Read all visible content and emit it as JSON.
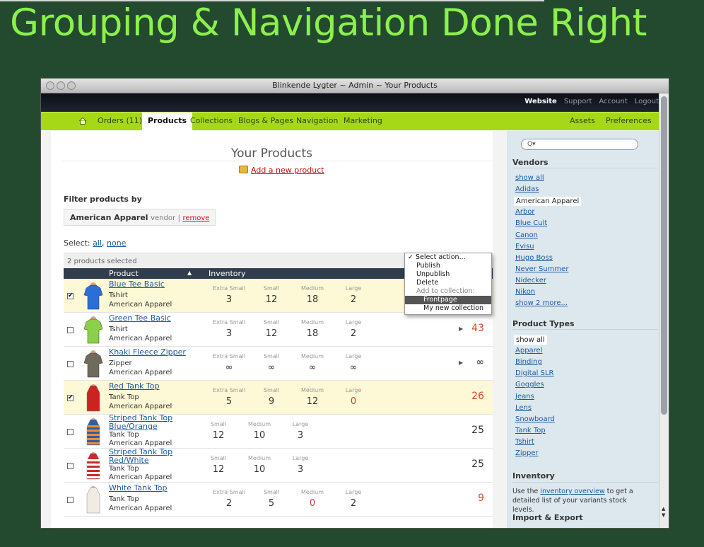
{
  "slide": {
    "title": "Grouping & Navigation Done Right"
  },
  "window": {
    "title": "Blinkende Lygter ~ Admin ~ Your Products"
  },
  "topnav": [
    "Website",
    "Support",
    "Account",
    "Logout"
  ],
  "tabs": {
    "left": [
      "Orders (11)",
      "Products",
      "Collections",
      "Blogs & Pages",
      "Navigation",
      "Marketing"
    ],
    "right": [
      "Assets",
      "Preferences"
    ],
    "active": "Products"
  },
  "main": {
    "title": "Your Products",
    "add_link": "Add a new product",
    "filter_heading": "Filter products by",
    "filter_value": "American Apparel",
    "filter_kind": "vendor",
    "filter_sep": "|",
    "filter_remove": "remove",
    "select_label": "Select:",
    "select_all": "all",
    "select_comma": ",",
    "select_none": "none",
    "selected_count": "2 products selected",
    "col_product": "Product",
    "col_inventory": "Inventory"
  },
  "dropdown": {
    "items": [
      "Select action...",
      "Publish",
      "Unpublish",
      "Delete",
      "Add to collection:",
      "Frontpage",
      "My new collection"
    ],
    "checkmark": "✓"
  },
  "products": [
    {
      "name": "Blue Tee Basic",
      "type": "Tshirt",
      "vendor": "American Apparel",
      "checked": true,
      "variants": [
        {
          "label": "Extra Small",
          "qty": "3"
        },
        {
          "label": "Small",
          "qty": "12"
        },
        {
          "label": "Medium",
          "qty": "18"
        },
        {
          "label": "Large",
          "qty": "2"
        }
      ],
      "total": "",
      "total_color": "#333333",
      "arrow": false,
      "thumb": "blue-tee"
    },
    {
      "name": "Green Tee Basic",
      "type": "Tshirt",
      "vendor": "American Apparel",
      "checked": false,
      "variants": [
        {
          "label": "Extra Small",
          "qty": "3"
        },
        {
          "label": "Small",
          "qty": "12"
        },
        {
          "label": "Medium",
          "qty": "18"
        },
        {
          "label": "Large",
          "qty": "2"
        }
      ],
      "total": "43",
      "total_color": "#d04a2a",
      "arrow": true,
      "thumb": "green-tee"
    },
    {
      "name": "Khaki Fleece Zipper",
      "type": "Zipper",
      "vendor": "American Apparel",
      "checked": false,
      "variants": [
        {
          "label": "Extra Small",
          "qty": "∞"
        },
        {
          "label": "Small",
          "qty": "∞"
        },
        {
          "label": "Medium",
          "qty": "∞"
        },
        {
          "label": "Large",
          "qty": "∞"
        }
      ],
      "total": "∞",
      "total_color": "#333333",
      "arrow": true,
      "thumb": "khaki-zipper"
    },
    {
      "name": "Red Tank Top",
      "type": "Tank Top",
      "vendor": "American Apparel",
      "checked": true,
      "variants": [
        {
          "label": "Extra Small",
          "qty": "5"
        },
        {
          "label": "Small",
          "qty": "9"
        },
        {
          "label": "Medium",
          "qty": "12"
        },
        {
          "label": "Large",
          "qty": "0"
        }
      ],
      "total": "26",
      "total_color": "#d04a2a",
      "arrow": false,
      "thumb": "red-tank"
    },
    {
      "name": "Striped Tank Top Blue/Orange",
      "type": "Tank Top",
      "vendor": "American Apparel",
      "checked": false,
      "variants": [
        {
          "label": "Small",
          "qty": "12"
        },
        {
          "label": "Medium",
          "qty": "10"
        },
        {
          "label": "Large",
          "qty": "3"
        }
      ],
      "total": "25",
      "total_color": "#333333",
      "arrow": false,
      "thumb": "striped-blue"
    },
    {
      "name": "Striped Tank Top Red/White",
      "type": "Tank Top",
      "vendor": "American Apparel",
      "checked": false,
      "variants": [
        {
          "label": "Small",
          "qty": "12"
        },
        {
          "label": "Medium",
          "qty": "10"
        },
        {
          "label": "Large",
          "qty": "3"
        }
      ],
      "total": "25",
      "total_color": "#333333",
      "arrow": false,
      "thumb": "striped-red"
    },
    {
      "name": "White Tank Top",
      "type": "Tank Top",
      "vendor": "American Apparel",
      "checked": false,
      "variants": [
        {
          "label": "Extra Small",
          "qty": "2"
        },
        {
          "label": "Small",
          "qty": "5"
        },
        {
          "label": "Medium",
          "qty": "0"
        },
        {
          "label": "Large",
          "qty": "2"
        }
      ],
      "total": "9",
      "total_color": "#d04a2a",
      "arrow": false,
      "thumb": "white-tank"
    }
  ],
  "sidebar": {
    "search_placeholder": "Q▾",
    "vendors_heading": "Vendors",
    "vendors": [
      "show all",
      "Adidas",
      "American Apparel",
      "Arbor",
      "Blue Cult",
      "Canon",
      "Evisu",
      "Hugo Boss",
      "Never Summer",
      "Nidecker",
      "Nikon",
      "show 2 more..."
    ],
    "vendors_active": "American Apparel",
    "types_heading": "Product Types",
    "types": [
      "show all",
      "Apparel",
      "Binding",
      "Digital SLR",
      "Goggles",
      "Jeans",
      "Lens",
      "Snowboard",
      "Tank Top",
      "Tshirt",
      "Zipper"
    ],
    "types_active": "show all",
    "inventory_heading": "Inventory",
    "inventory_pre": "Use the",
    "inventory_link": "inventory overview",
    "inventory_post": "to get a detailed list of your variants stock levels.",
    "import_heading": "Import & Export"
  },
  "colors": {
    "slide_bg": "#234a2e",
    "title_green": "#8cf04c",
    "nav_green": "#a6d818",
    "link_blue": "#1d5aa0",
    "alert_red": "#d04a2a"
  }
}
